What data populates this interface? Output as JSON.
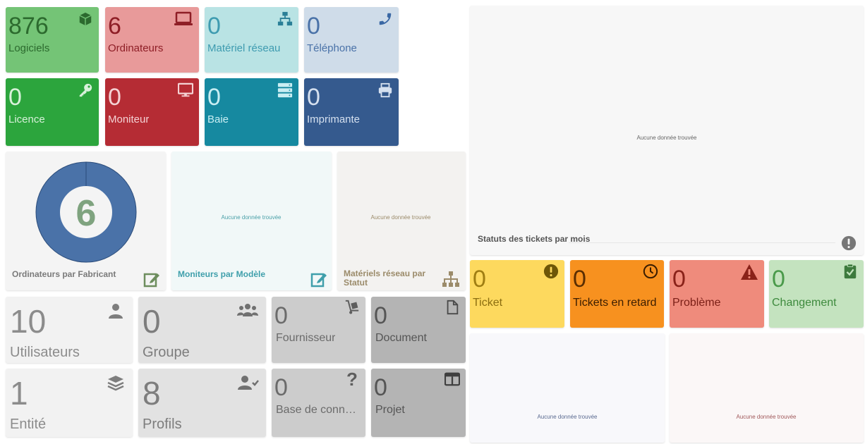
{
  "assets": [
    {
      "id": "logiciels",
      "value": "876",
      "label": "Logiciels",
      "icon": "cube-icon"
    },
    {
      "id": "ordinateurs",
      "value": "6",
      "label": "Ordinateurs",
      "icon": "laptop-icon"
    },
    {
      "id": "materiel-reseau",
      "value": "0",
      "label": "Matériel réseau",
      "icon": "network-icon"
    },
    {
      "id": "telephone",
      "value": "0",
      "label": "Téléphone",
      "icon": "phone-icon"
    },
    {
      "id": "licence",
      "value": "0",
      "label": "Licence",
      "icon": "key-icon"
    },
    {
      "id": "moniteur",
      "value": "0",
      "label": "Moniteur",
      "icon": "monitor-icon"
    },
    {
      "id": "baie",
      "value": "0",
      "label": "Baie",
      "icon": "server-icon"
    },
    {
      "id": "imprimante",
      "value": "0",
      "label": "Imprimante",
      "icon": "printer-icon"
    }
  ],
  "charts": {
    "ordinateurs_fabricant": {
      "title": "Ordinateurs par Fabricant",
      "center_value": "6"
    },
    "moniteurs_modele": {
      "title": "Moniteurs par Modèle",
      "empty": "Aucune donnée trouvée"
    },
    "materiels_statut": {
      "title": "Matériels réseau par Statut",
      "empty": "Aucune donnée trouvée"
    },
    "tickets_mois": {
      "title": "Statuts des tickets par mois",
      "empty": "Aucune donnée trouvée"
    },
    "bottom_left": {
      "empty": "Aucune donnée trouvée"
    },
    "bottom_right": {
      "empty": "Aucune donnée trouvée"
    }
  },
  "admin": [
    {
      "id": "utilisateurs",
      "value": "10",
      "label": "Utilisateurs",
      "icon": "user-icon"
    },
    {
      "id": "groupe",
      "value": "0",
      "label": "Groupe",
      "icon": "users-icon"
    },
    {
      "id": "fournisseur",
      "value": "0",
      "label": "Fournisseur",
      "icon": "dolly-icon"
    },
    {
      "id": "document",
      "value": "0",
      "label": "Document",
      "icon": "file-icon"
    },
    {
      "id": "entite",
      "value": "1",
      "label": "Entité",
      "icon": "layers-icon"
    },
    {
      "id": "profils",
      "value": "8",
      "label": "Profils",
      "icon": "user-check-icon"
    },
    {
      "id": "base-connaissances",
      "value": "0",
      "label": "Base de conn…",
      "icon": "question-icon"
    },
    {
      "id": "projet",
      "value": "0",
      "label": "Projet",
      "icon": "columns-icon"
    }
  ],
  "tickets": [
    {
      "id": "ticket",
      "value": "0",
      "label": "Ticket",
      "icon": "exclamation-circle-icon"
    },
    {
      "id": "tickets-retard",
      "value": "0",
      "label": "Tickets en retard",
      "icon": "clock-icon"
    },
    {
      "id": "probleme",
      "value": "0",
      "label": "Problème",
      "icon": "warning-icon"
    },
    {
      "id": "changement",
      "value": "0",
      "label": "Changement",
      "icon": "clipboard-check-icon"
    }
  ],
  "colors": {
    "green_light": "#74c476",
    "red_light": "#e89a9a",
    "cyan_light": "#b9e3e4",
    "blue_light": "#cfdce9",
    "green": "#2ca53d",
    "red": "#b52c34",
    "teal": "#1689a0",
    "navy": "#355a8e",
    "donut": "#4a72a8",
    "ticket_yellow": "#fdd95e",
    "ticket_orange": "#f7911f",
    "ticket_salmon": "#ef8b7c",
    "ticket_green": "#c4e3bf"
  }
}
